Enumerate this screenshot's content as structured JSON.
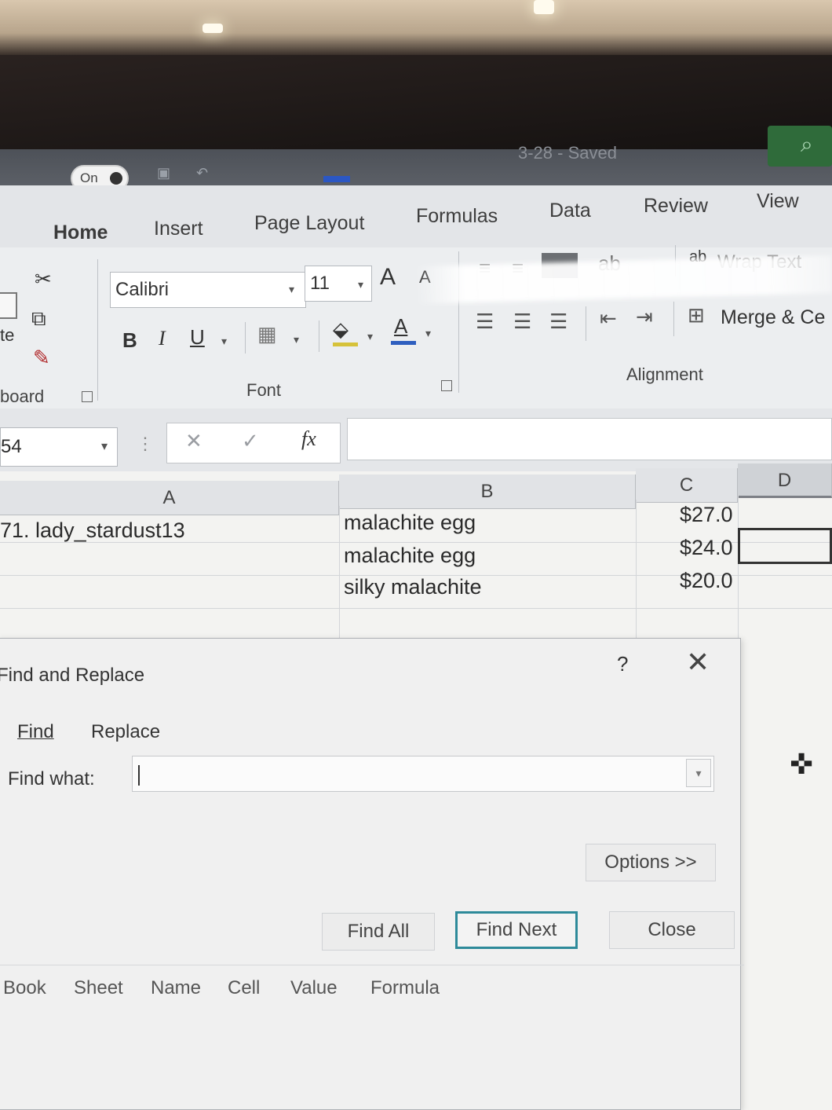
{
  "titlebar": {
    "autosave_state": "On",
    "doc_status": "3-28 - Saved"
  },
  "tabs": [
    "Home",
    "Insert",
    "Page Layout",
    "Formulas",
    "Data",
    "Review",
    "View"
  ],
  "ribbon": {
    "paste_label_fragment": "te",
    "clipboard_group": "board",
    "font_name": "Calibri",
    "font_size": "11",
    "bold": "B",
    "italic": "I",
    "underline": "U",
    "font_group": "Font",
    "wrap_text": "Wrap Text",
    "wrap_ab": "ab",
    "merge_center": "Merge & Ce",
    "alignment_group": "Alignment",
    "grow_font": "A",
    "shrink_font": "A",
    "font_color_letter": "A",
    "accent_fill": "#d6c23a",
    "accent_font": "#2f5fbf"
  },
  "formula_bar": {
    "name_box": "54",
    "cancel": "✕",
    "enter": "✓",
    "fx": "fx",
    "content": ""
  },
  "sheet": {
    "columns": [
      "A",
      "B",
      "C",
      "D"
    ],
    "rows": [
      {
        "a": "71. lady_stardust13",
        "b": "malachite egg",
        "c": "$27.0"
      },
      {
        "a": "",
        "b": "malachite egg",
        "c": "$24.0"
      },
      {
        "a": "",
        "b": "silky malachite",
        "c": "$20.0"
      }
    ]
  },
  "dialog": {
    "title": "Find and Replace",
    "help": "?",
    "close_icon": "✕",
    "tab_find": "Find",
    "tab_replace": "Replace",
    "find_what_label": "Find what:",
    "find_what_value": "",
    "options_button": "Options >>",
    "find_all_button": "Find All",
    "find_next_button": "Find Next",
    "close_button": "Close",
    "result_columns": [
      "Book",
      "Sheet",
      "Name",
      "Cell",
      "Value",
      "Formula"
    ]
  }
}
